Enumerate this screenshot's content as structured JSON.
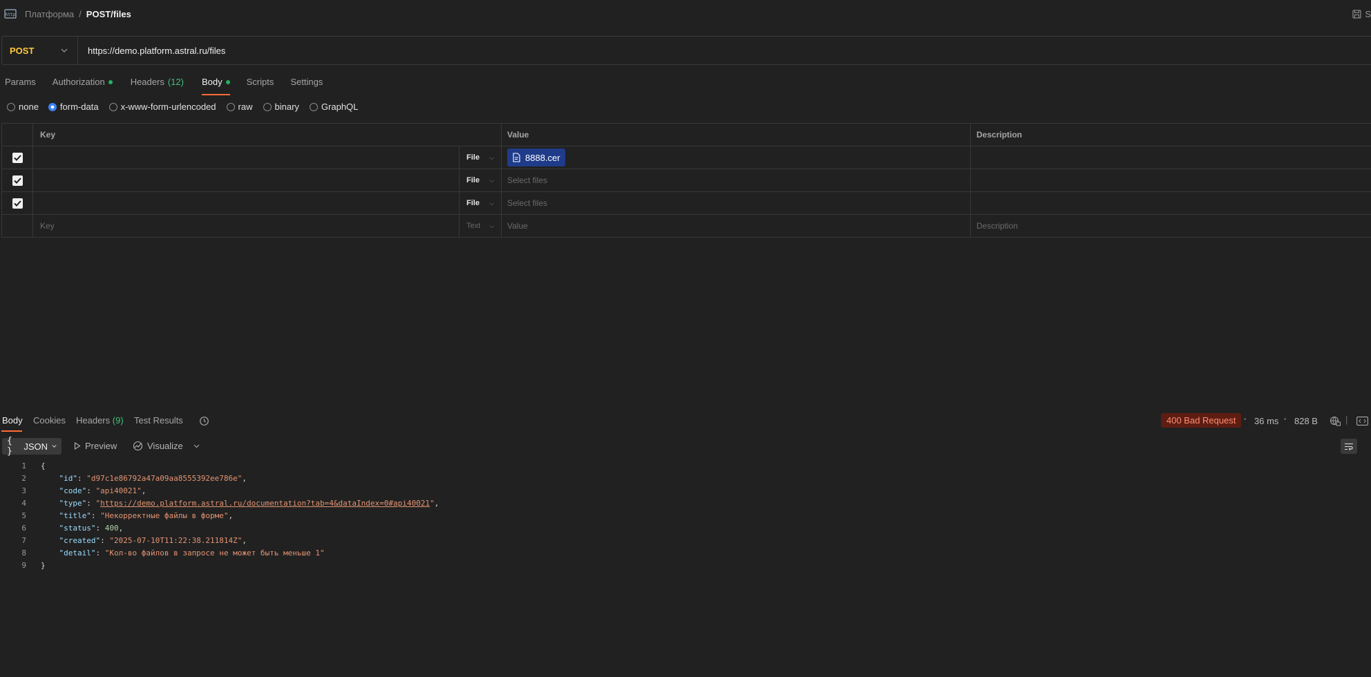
{
  "breadcrumb": {
    "parent": "Платформа",
    "separator": "/",
    "current": "POST/files"
  },
  "save": {
    "label": "S"
  },
  "request": {
    "method": "POST",
    "url": "https://demo.platform.astral.ru/files"
  },
  "req_tabs": {
    "params": "Params",
    "authorization": "Authorization",
    "headers": "Headers",
    "headers_count": "(12)",
    "body": "Body",
    "scripts": "Scripts",
    "settings": "Settings"
  },
  "body_types": {
    "none": "none",
    "form_data": "form-data",
    "urlencoded": "x-www-form-urlencoded",
    "raw": "raw",
    "binary": "binary",
    "graphql": "GraphQL",
    "selected": "form-data"
  },
  "table": {
    "headers": {
      "key": "Key",
      "value": "Value",
      "description": "Description"
    },
    "rows": [
      {
        "checked": true,
        "key": "",
        "type": "File",
        "file": "8888.cer"
      },
      {
        "checked": true,
        "key": "",
        "type": "File",
        "value_placeholder": "Select files"
      },
      {
        "checked": true,
        "key": "",
        "type": "File",
        "value_placeholder": "Select files"
      }
    ],
    "new_row": {
      "key_placeholder": "Key",
      "type": "Text",
      "value_placeholder": "Value",
      "description_placeholder": "Description"
    }
  },
  "response": {
    "tabs": {
      "body": "Body",
      "cookies": "Cookies",
      "headers": "Headers",
      "headers_count": "(9)",
      "tests": "Test Results"
    },
    "status": "400 Bad Request",
    "time": "36 ms",
    "size": "828 B",
    "format": "JSON",
    "preview": "Preview",
    "visualize": "Visualize",
    "lines": {
      "l1": "{",
      "id_key": "\"id\"",
      "id_val": "\"d97c1e86792a47a09aa8555392ee786e\"",
      "code_key": "\"code\"",
      "code_val": "\"api40021\"",
      "type_key": "\"type\"",
      "type_val": "https://demo.platform.astral.ru/documentation?tab=4&dataIndex=0#api40021",
      "title_key": "\"title\"",
      "title_val": "\"Некорректные файлы в форме\"",
      "status_key": "\"status\"",
      "status_val": "400",
      "created_key": "\"created\"",
      "created_val": "\"2025-07-10T11:22:38.211814Z\"",
      "detail_key": "\"detail\"",
      "detail_val": "\"Кол-во файлов в запросе не может быть меньше 1\"",
      "l9": "}"
    },
    "line_numbers": [
      "1",
      "2",
      "3",
      "4",
      "5",
      "6",
      "7",
      "8",
      "9"
    ]
  },
  "colors": {
    "accent": "#ff6c37",
    "method": "#ffc83b",
    "error": "#ff8f73",
    "success_dot": "#23b35f"
  }
}
